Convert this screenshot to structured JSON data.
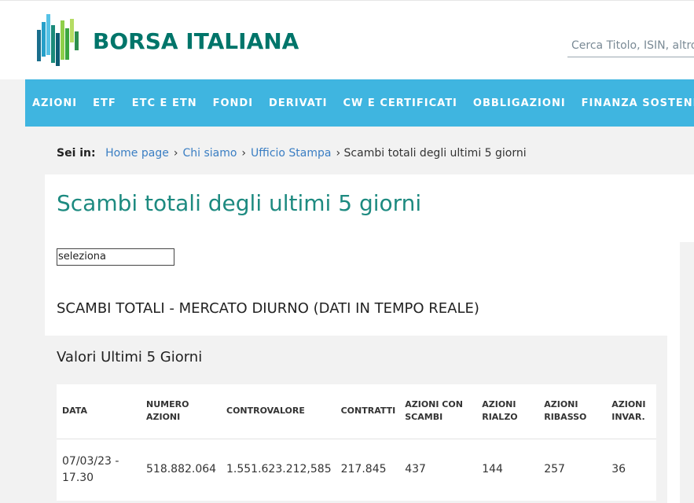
{
  "header": {
    "brand": "BORSA ITALIANA",
    "search_placeholder": "Cerca Titolo, ISIN, altro"
  },
  "nav": {
    "items": [
      "AZIONI",
      "ETF",
      "ETC E ETN",
      "FONDI",
      "DERIVATI",
      "CW E CERTIFICATI",
      "OBBLIGAZIONI",
      "FINANZA SOSTENIBILE"
    ]
  },
  "breadcrumb": {
    "label": "Sei in:",
    "links": [
      "Home page",
      "Chi siamo",
      "Ufficio Stampa"
    ],
    "current": "Scambi totali degli ultimi 5 giorni"
  },
  "main": {
    "title": "Scambi totali degli ultimi 5 giorni",
    "select_value": "seleziona",
    "section_title": "SCAMBI TOTALI - MERCATO DIURNO (DATI IN TEMPO REALE)",
    "panel_title": "Valori Ultimi 5 Giorni"
  },
  "table": {
    "headers": [
      "DATA",
      "NUMERO AZIONI",
      "CONTROVALORE",
      "CONTRATTI",
      "AZIONI CON SCAMBI",
      "AZIONI RIALZO",
      "AZIONI RIBASSO",
      "AZIONI INVAR."
    ],
    "rows": [
      [
        "07/03/23 - 17.30",
        "518.882.064",
        "1.551.623.212,585",
        "217.845",
        "437",
        "144",
        "257",
        "36"
      ]
    ]
  },
  "colors": {
    "brand": "#00756a",
    "nav_bg": "#3fb5e0",
    "title": "#1d8a80",
    "link": "#3a7ec3"
  }
}
